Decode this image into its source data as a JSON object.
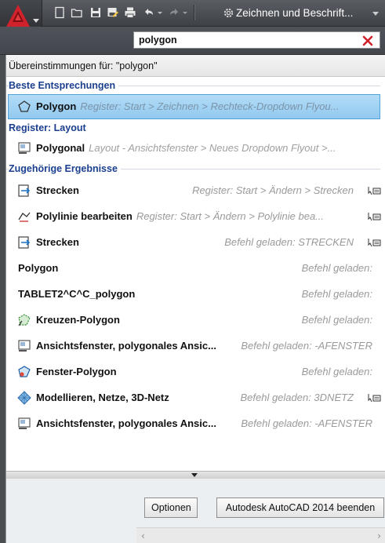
{
  "toolbar": {
    "workspace_label": "Zeichnen und Beschrift..."
  },
  "search": {
    "value": "polygon"
  },
  "results": {
    "header": "Übereinstimmungen für: \"polygon\"",
    "sections": {
      "best": "Beste Entsprechungen",
      "layout": "Register: Layout",
      "related": "Zugehörige Ergebnisse"
    },
    "best": {
      "name": "Polygon",
      "path": "Register: Start > Zeichnen > Rechteck-Dropdown Flyou..."
    },
    "layout": {
      "name": "Polygonal",
      "path": "Layout - Ansichtsfenster > Neues Dropdown Flyout >..."
    },
    "related": [
      {
        "name": "Strecken",
        "path": "Register: Start > Ändern > Strecken"
      },
      {
        "name": "Polylinie bearbeiten",
        "path": "Register: Start > Ändern > Polylinie bea..."
      },
      {
        "name": "Strecken",
        "path": "Befehl geladen: STRECKEN"
      },
      {
        "name": "Polygon",
        "path": "Befehl geladen:"
      },
      {
        "name": "TABLET2^C^C_polygon",
        "path": "Befehl geladen:"
      },
      {
        "name": "Kreuzen-Polygon",
        "path": "Befehl geladen:"
      },
      {
        "name": "Ansichtsfenster, polygonales Ansic...",
        "path": "Befehl geladen: -AFENSTER"
      },
      {
        "name": "Fenster-Polygon",
        "path": "Befehl geladen:"
      },
      {
        "name": "Modellieren, Netze, 3D-Netz",
        "path": "Befehl geladen: 3DNETZ"
      },
      {
        "name": "Ansichtsfenster, polygonales Ansic...",
        "path": "Befehl geladen: -AFENSTER"
      }
    ]
  },
  "footer": {
    "options_label": "Optionen",
    "exit_label": "Autodesk AutoCAD 2014 beenden"
  },
  "icons": {
    "app": "autocad-logo-icon",
    "new": "new-file-icon",
    "open": "open-folder-icon",
    "save": "save-icon",
    "save_as": "save-as-icon",
    "print": "print-icon",
    "undo": "undo-icon",
    "redo": "redo-icon",
    "workspace": "gear-icon",
    "clear": "clear-x-icon"
  },
  "colors": {
    "accent_red": "#c8202a",
    "section_blue": "#1b3f8f",
    "selection_bg": "#a6d4f2"
  }
}
